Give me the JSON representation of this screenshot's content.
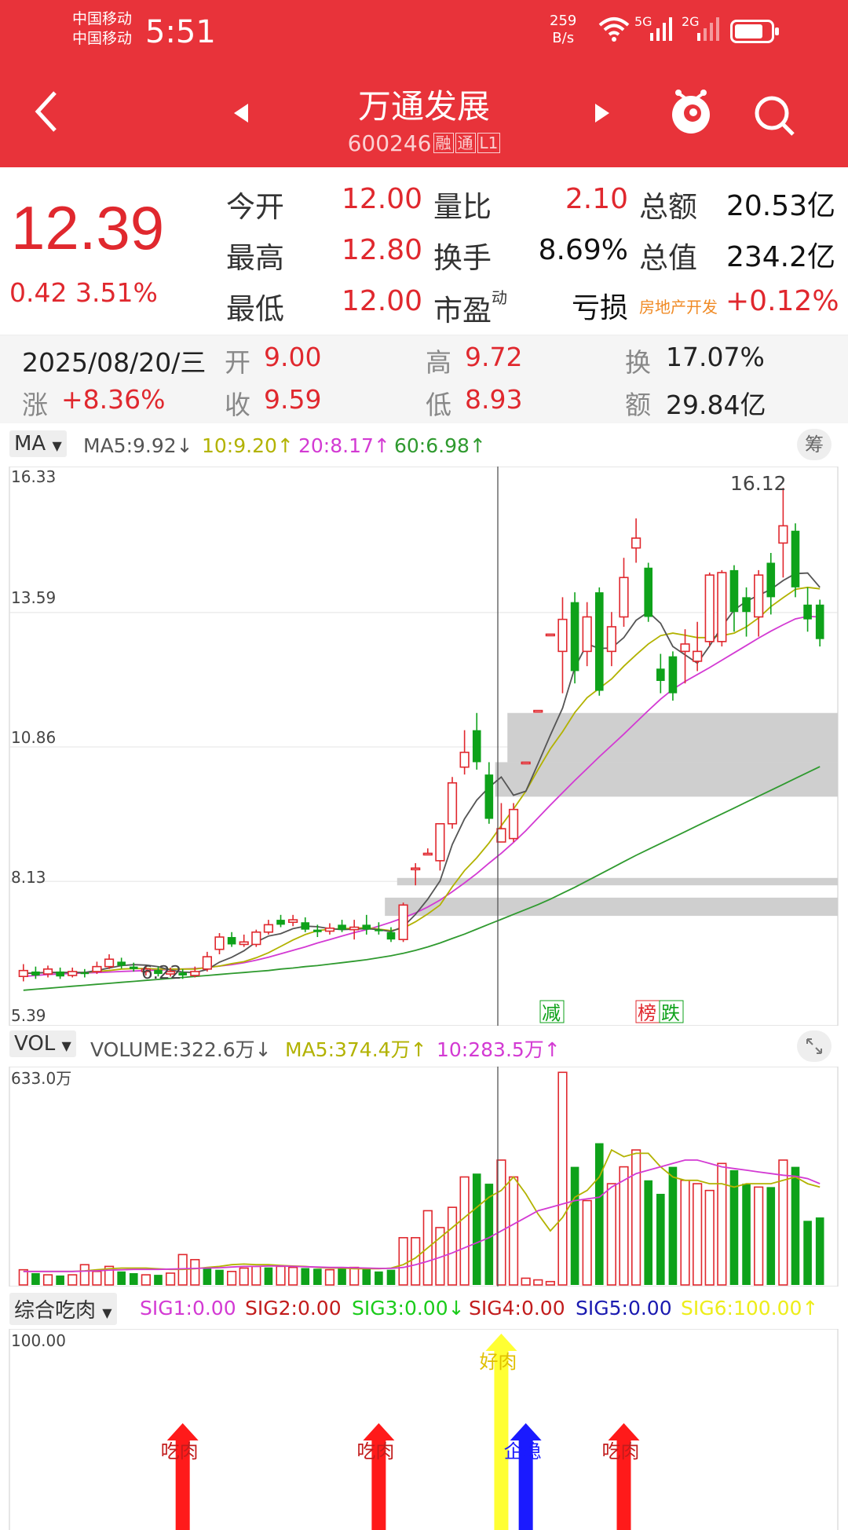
{
  "status": {
    "carrier1": "中国移动",
    "carrier2": "中国移动",
    "time": "5:51",
    "speed_value": "259",
    "speed_unit": "B/s",
    "net1": "5G",
    "net2": "2G"
  },
  "header": {
    "title": "万通发展",
    "code": "600246",
    "tags": [
      "融",
      "通",
      "L1"
    ]
  },
  "quote": {
    "price": "12.39",
    "change": "0.42 3.51%",
    "rows": [
      {
        "l1": "今开",
        "v1": "12.00",
        "l2": "量比",
        "v2": "2.10",
        "l3": "总额",
        "v3": "20.53亿"
      },
      {
        "l1": "最高",
        "v1": "12.80",
        "l2": "换手",
        "v2": "8.69%",
        "l3": "总值",
        "v3": "234.2亿"
      },
      {
        "l1": "最低",
        "v1": "12.00",
        "l2": "市盈",
        "l2sup": "动",
        "v2": "亏损",
        "l3": "房地产开发",
        "v3": "+0.12%"
      }
    ]
  },
  "day": {
    "date": "2025/08/20/三",
    "open_label": "开",
    "open": "9.00",
    "high_label": "高",
    "high": "9.72",
    "turn_label": "换",
    "turn": "17.07%",
    "chg_label": "涨",
    "chg": "+8.36%",
    "close_label": "收",
    "close": "9.59",
    "low_label": "低",
    "low": "8.93",
    "amt_label": "额",
    "amt": "29.84亿"
  },
  "ma_bar": {
    "selector": "MA",
    "ma5": "MA5:9.92↓",
    "ma10": "10:9.20↑",
    "ma20": "20:8.17↑",
    "ma60": "60:6.98↑",
    "chip": "筹"
  },
  "kline": {
    "y_labels": [
      "16.33",
      "13.59",
      "10.86",
      "8.13",
      "5.39"
    ],
    "high_marker": "16.12",
    "low_marker": "6.22",
    "badges": [
      "减",
      "榜",
      "跌"
    ]
  },
  "vol_bar": {
    "selector": "VOL",
    "volume": "VOLUME:322.6万↓",
    "ma5": "MA5:374.4万↑",
    "ma10": "10:283.5万↑",
    "y_label": "633.0万"
  },
  "sig_bar": {
    "selector": "综合吃肉",
    "sig1": "SIG1:0.00",
    "sig2": "SIG2:0.00",
    "sig3": "SIG3:0.00↓",
    "sig4": "SIG4:0.00",
    "sig5": "SIG5:0.00",
    "sig6": "SIG6:100.00↑",
    "y_label": "100.00",
    "arrow_labels": [
      "吃肉",
      "吃肉",
      "好肉",
      "企稳",
      "吃肉"
    ]
  },
  "colors": {
    "brand_red": "#e8333a",
    "up": "#e0282e",
    "down": "#0ea21a",
    "ma5": "#555555",
    "ma10": "#b2b200",
    "ma20": "#d33ad3",
    "ma60": "#2f9a2f"
  },
  "chart_data": {
    "type": "candlestick",
    "y_range": [
      5.39,
      16.33
    ],
    "candles": [
      {
        "o": 6.2,
        "c": 6.32,
        "h": 6.45,
        "l": 6.1
      },
      {
        "o": 6.3,
        "c": 6.22,
        "h": 6.4,
        "l": 6.15
      },
      {
        "o": 6.25,
        "c": 6.35,
        "h": 6.42,
        "l": 6.18
      },
      {
        "o": 6.3,
        "c": 6.2,
        "h": 6.38,
        "l": 6.15
      },
      {
        "o": 6.22,
        "c": 6.3,
        "h": 6.38,
        "l": 6.18
      },
      {
        "o": 6.28,
        "c": 6.25,
        "h": 6.35,
        "l": 6.18
      },
      {
        "o": 6.3,
        "c": 6.4,
        "h": 6.5,
        "l": 6.25
      },
      {
        "o": 6.4,
        "c": 6.55,
        "h": 6.65,
        "l": 6.35
      },
      {
        "o": 6.5,
        "c": 6.42,
        "h": 6.58,
        "l": 6.36
      },
      {
        "o": 6.4,
        "c": 6.35,
        "h": 6.48,
        "l": 6.3
      },
      {
        "o": 6.3,
        "c": 6.35,
        "h": 6.42,
        "l": 6.22
      },
      {
        "o": 6.33,
        "c": 6.25,
        "h": 6.4,
        "l": 6.2
      },
      {
        "o": 6.25,
        "c": 6.3,
        "h": 6.38,
        "l": 6.2
      },
      {
        "o": 6.28,
        "c": 6.22,
        "h": 6.35,
        "l": 6.15
      },
      {
        "o": 6.22,
        "c": 6.3,
        "h": 6.4,
        "l": 6.18
      },
      {
        "o": 6.35,
        "c": 6.6,
        "h": 6.7,
        "l": 6.3
      },
      {
        "o": 6.75,
        "c": 7.0,
        "h": 7.08,
        "l": 6.65
      },
      {
        "o": 7.0,
        "c": 6.85,
        "h": 7.1,
        "l": 6.8
      },
      {
        "o": 6.85,
        "c": 6.9,
        "h": 7.05,
        "l": 6.8
      },
      {
        "o": 6.85,
        "c": 7.1,
        "h": 7.15,
        "l": 6.8
      },
      {
        "o": 7.1,
        "c": 7.25,
        "h": 7.35,
        "l": 7.05
      },
      {
        "o": 7.35,
        "c": 7.25,
        "h": 7.45,
        "l": 7.2
      },
      {
        "o": 7.3,
        "c": 7.35,
        "h": 7.45,
        "l": 7.22
      },
      {
        "o": 7.3,
        "c": 7.15,
        "h": 7.4,
        "l": 7.1
      },
      {
        "o": 7.15,
        "c": 7.1,
        "h": 7.25,
        "l": 7.0
      },
      {
        "o": 7.12,
        "c": 7.18,
        "h": 7.28,
        "l": 7.05
      },
      {
        "o": 7.25,
        "c": 7.15,
        "h": 7.35,
        "l": 7.1
      },
      {
        "o": 7.15,
        "c": 7.2,
        "h": 7.35,
        "l": 6.95
      },
      {
        "o": 7.25,
        "c": 7.15,
        "h": 7.45,
        "l": 7.05
      },
      {
        "o": 7.15,
        "c": 7.12,
        "h": 7.3,
        "l": 7.05
      },
      {
        "o": 7.1,
        "c": 6.95,
        "h": 7.2,
        "l": 6.9
      },
      {
        "o": 6.95,
        "c": 7.65,
        "h": 7.7,
        "l": 6.9
      },
      {
        "o": 8.4,
        "c": 8.4,
        "h": 8.5,
        "l": 8.05
      },
      {
        "o": 8.7,
        "c": 8.7,
        "h": 8.8,
        "l": 8.7
      },
      {
        "o": 8.55,
        "c": 9.3,
        "h": 9.3,
        "l": 8.35
      },
      {
        "o": 9.3,
        "c": 10.13,
        "h": 10.25,
        "l": 9.2
      },
      {
        "o": 10.45,
        "c": 10.75,
        "h": 11.2,
        "l": 10.3
      },
      {
        "o": 11.2,
        "c": 10.55,
        "h": 11.55,
        "l": 10.4
      },
      {
        "o": 10.3,
        "c": 9.4,
        "h": 10.55,
        "l": 9.3
      },
      {
        "o": 8.93,
        "c": 9.2,
        "h": 9.72,
        "l": 8.93
      },
      {
        "o": 9.0,
        "c": 9.59,
        "h": 9.72,
        "l": 8.93
      },
      {
        "o": 10.55,
        "c": 10.55,
        "h": 10.55,
        "l": 10.55
      },
      {
        "o": 11.6,
        "c": 11.6,
        "h": 11.6,
        "l": 11.6
      },
      {
        "o": 13.15,
        "c": 13.15,
        "h": 13.15,
        "l": 13.15
      },
      {
        "o": 12.8,
        "c": 13.45,
        "h": 13.9,
        "l": 11.95
      },
      {
        "o": 13.8,
        "c": 12.4,
        "h": 14.0,
        "l": 12.15
      },
      {
        "o": 12.8,
        "c": 13.5,
        "h": 13.8,
        "l": 12.5
      },
      {
        "o": 14.0,
        "c": 12.0,
        "h": 14.1,
        "l": 11.9
      },
      {
        "o": 12.8,
        "c": 13.3,
        "h": 13.6,
        "l": 12.5
      },
      {
        "o": 13.5,
        "c": 14.3,
        "h": 14.7,
        "l": 13.3
      },
      {
        "o": 14.9,
        "c": 15.1,
        "h": 15.5,
        "l": 14.6
      },
      {
        "o": 14.5,
        "c": 13.5,
        "h": 14.6,
        "l": 13.4
      },
      {
        "o": 12.45,
        "c": 12.2,
        "h": 12.75,
        "l": 11.95
      },
      {
        "o": 12.7,
        "c": 11.95,
        "h": 12.8,
        "l": 11.8
      },
      {
        "o": 12.8,
        "c": 12.95,
        "h": 13.25,
        "l": 12.15
      },
      {
        "o": 12.6,
        "c": 12.8,
        "h": 13.4,
        "l": 12.4
      },
      {
        "o": 13.0,
        "c": 14.35,
        "h": 14.4,
        "l": 12.9
      },
      {
        "o": 13.0,
        "c": 14.4,
        "h": 14.45,
        "l": 12.9
      },
      {
        "o": 14.45,
        "c": 13.6,
        "h": 14.55,
        "l": 13.2
      },
      {
        "o": 13.9,
        "c": 13.6,
        "h": 14.1,
        "l": 13.1
      },
      {
        "o": 13.5,
        "c": 14.35,
        "h": 14.45,
        "l": 13.1
      },
      {
        "o": 14.6,
        "c": 13.9,
        "h": 14.8,
        "l": 13.55
      },
      {
        "o": 15.0,
        "c": 15.35,
        "h": 16.12,
        "l": 14.3
      },
      {
        "o": 15.25,
        "c": 14.1,
        "h": 15.4,
        "l": 13.9
      },
      {
        "o": 13.75,
        "c": 13.45,
        "h": 14.1,
        "l": 13.2
      },
      {
        "o": 13.75,
        "c": 13.05,
        "h": 13.85,
        "l": 12.9
      }
    ],
    "ma5": [
      6.26,
      6.27,
      6.28,
      6.28,
      6.28,
      6.28,
      6.32,
      6.37,
      6.42,
      6.44,
      6.43,
      6.4,
      6.33,
      6.29,
      6.28,
      6.34,
      6.49,
      6.59,
      6.72,
      6.9,
      7.02,
      7.07,
      7.17,
      7.22,
      7.21,
      7.17,
      7.15,
      7.16,
      7.17,
      7.15,
      7.11,
      7.21,
      7.46,
      7.77,
      8.14,
      8.88,
      9.4,
      9.78,
      10.04,
      10.25,
      9.88,
      9.96,
      10.52,
      11.1,
      11.65,
      12.47,
      12.95,
      12.86,
      12.87,
      13.08,
      13.43,
      13.6,
      13.37,
      12.9,
      12.73,
      12.56,
      12.91,
      13.3,
      13.64,
      13.82,
      13.94,
      14.06,
      14.24,
      14.38,
      14.39,
      14.1
    ],
    "ma10": [
      6.26,
      6.27,
      6.28,
      6.28,
      6.28,
      6.28,
      6.3,
      6.32,
      6.35,
      6.36,
      6.36,
      6.35,
      6.35,
      6.35,
      6.35,
      6.38,
      6.41,
      6.46,
      6.5,
      6.58,
      6.68,
      6.81,
      6.94,
      7.05,
      7.13,
      7.16,
      7.17,
      7.18,
      7.19,
      7.16,
      7.13,
      7.18,
      7.31,
      7.47,
      7.65,
      8.02,
      8.35,
      8.61,
      8.91,
      9.26,
      9.6,
      9.96,
      10.4,
      10.82,
      11.17,
      11.56,
      11.86,
      12.05,
      12.24,
      12.5,
      12.73,
      12.95,
      13.12,
      13.17,
      13.13,
      13.08,
      13.08,
      13.12,
      13.17,
      13.3,
      13.48,
      13.71,
      13.89,
      14.06,
      14.1,
      14.07
    ],
    "ma20": [
      6.2,
      6.22,
      6.24,
      6.25,
      6.26,
      6.27,
      6.28,
      6.29,
      6.3,
      6.31,
      6.32,
      6.33,
      6.34,
      6.35,
      6.36,
      6.38,
      6.41,
      6.44,
      6.48,
      6.53,
      6.59,
      6.66,
      6.73,
      6.8,
      6.88,
      6.95,
      7.02,
      7.09,
      7.15,
      7.22,
      7.3,
      7.39,
      7.49,
      7.61,
      7.75,
      7.92,
      8.1,
      8.29,
      8.5,
      8.7,
      8.92,
      9.16,
      9.42,
      9.68,
      9.93,
      10.18,
      10.42,
      10.66,
      10.89,
      11.12,
      11.36,
      11.6,
      11.83,
      12.03,
      12.19,
      12.33,
      12.47,
      12.62,
      12.77,
      12.92,
      13.07,
      13.21,
      13.34,
      13.46,
      13.51,
      13.5
    ],
    "ma60": [
      5.92,
      5.94,
      5.96,
      5.98,
      6.0,
      6.02,
      6.04,
      6.06,
      6.08,
      6.1,
      6.12,
      6.14,
      6.16,
      6.18,
      6.2,
      6.22,
      6.24,
      6.26,
      6.28,
      6.3,
      6.32,
      6.35,
      6.37,
      6.4,
      6.42,
      6.45,
      6.48,
      6.51,
      6.54,
      6.58,
      6.62,
      6.67,
      6.73,
      6.8,
      6.88,
      6.97,
      7.06,
      7.16,
      7.26,
      7.36,
      7.46,
      7.56,
      7.66,
      7.77,
      7.89,
      8.01,
      8.14,
      8.27,
      8.4,
      8.53,
      8.66,
      8.78,
      8.9,
      9.02,
      9.14,
      9.26,
      9.38,
      9.5,
      9.62,
      9.74,
      9.86,
      9.98,
      10.1,
      10.22,
      10.34,
      10.46
    ],
    "volume_ymax": 633.0,
    "volume": [
      45,
      35,
      30,
      28,
      30,
      60,
      40,
      55,
      40,
      35,
      30,
      30,
      35,
      90,
      75,
      50,
      45,
      40,
      50,
      55,
      52,
      55,
      52,
      50,
      48,
      45,
      50,
      52,
      48,
      40,
      45,
      140,
      140,
      220,
      170,
      230,
      320,
      330,
      300,
      370,
      320,
      20,
      15,
      10,
      630,
      350,
      250,
      420,
      300,
      350,
      400,
      310,
      270,
      350,
      310,
      300,
      280,
      360,
      340,
      300,
      290,
      290,
      370,
      350,
      190,
      200
    ],
    "volume_up": [
      true,
      false,
      true,
      false,
      true,
      true,
      true,
      true,
      false,
      false,
      true,
      false,
      true,
      true,
      true,
      false,
      false,
      true,
      true,
      true,
      false,
      true,
      true,
      false,
      false,
      true,
      false,
      true,
      false,
      false,
      false,
      true,
      true,
      true,
      true,
      true,
      true,
      false,
      false,
      true,
      true,
      true,
      true,
      true,
      true,
      false,
      true,
      false,
      true,
      true,
      true,
      false,
      false,
      false,
      true,
      true,
      true,
      true,
      false,
      false,
      true,
      false,
      true,
      false,
      false,
      false
    ],
    "vol_ma5": [
      40,
      40,
      40,
      40,
      40,
      42,
      45,
      48,
      50,
      50,
      50,
      48,
      46,
      46,
      48,
      52,
      55,
      60,
      62,
      60,
      60,
      58,
      56,
      55,
      52,
      50,
      50,
      48,
      48,
      48,
      50,
      60,
      80,
      110,
      140,
      170,
      200,
      230,
      260,
      280,
      320,
      270,
      210,
      160,
      200,
      260,
      280,
      320,
      400,
      380,
      390,
      390,
      350,
      320,
      310,
      310,
      300,
      300,
      290,
      300,
      300,
      300,
      310,
      320,
      300,
      290
    ],
    "vol_ma10": [
      40,
      40,
      40,
      40,
      40,
      41,
      42,
      44,
      45,
      46,
      46,
      46,
      47,
      48,
      49,
      50,
      51,
      53,
      55,
      55,
      56,
      56,
      55,
      54,
      53,
      52,
      52,
      51,
      50,
      49,
      49,
      52,
      60,
      70,
      82,
      95,
      110,
      125,
      140,
      160,
      180,
      200,
      220,
      230,
      240,
      250,
      255,
      260,
      290,
      310,
      330,
      340,
      350,
      360,
      370,
      370,
      360,
      350,
      345,
      340,
      335,
      330,
      325,
      322,
      315,
      300
    ],
    "sig_arrows": [
      {
        "index": 13,
        "label_index": 0,
        "color": "#ff1a1a"
      },
      {
        "index": 29,
        "label_index": 1,
        "color": "#ff1a1a"
      },
      {
        "index": 39,
        "label_index": 2,
        "color": "#ffff33"
      },
      {
        "index": 41,
        "label_index": 3,
        "color": "#1a1aff"
      },
      {
        "index": 49,
        "label_index": 4,
        "color": "#ff1a1a"
      }
    ]
  }
}
